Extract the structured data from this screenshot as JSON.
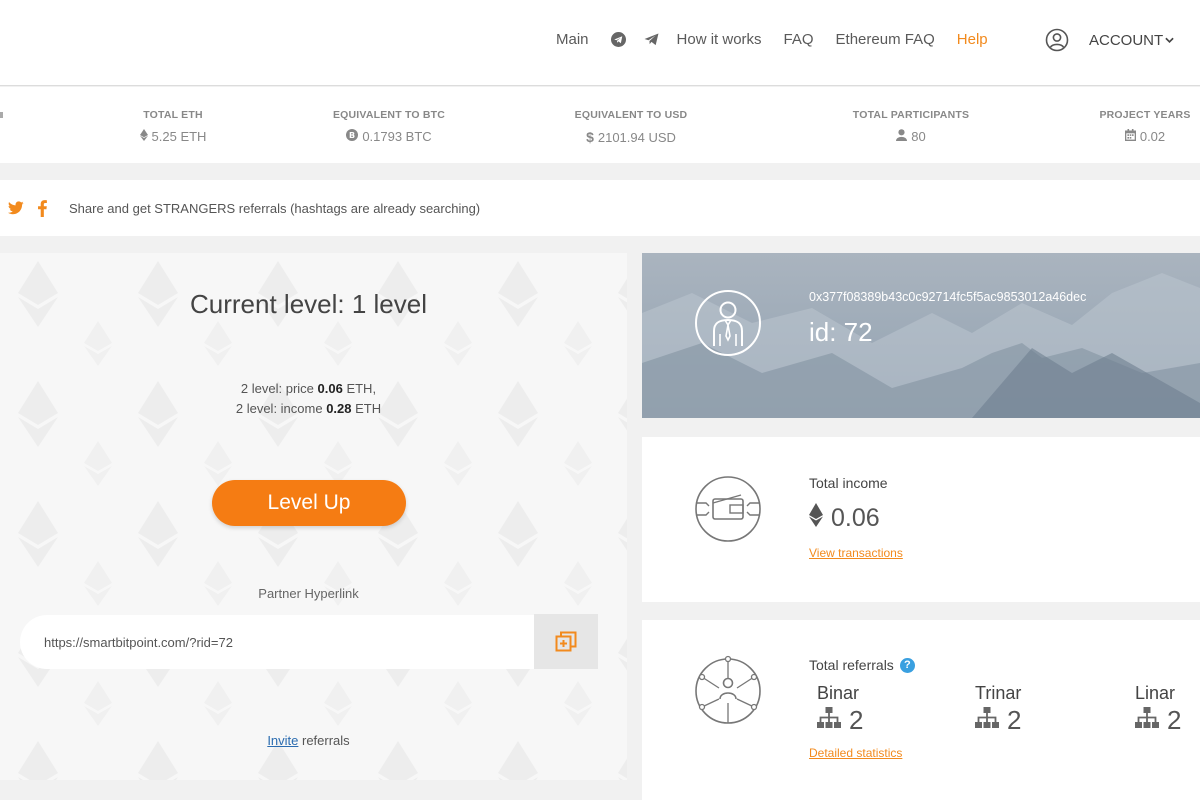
{
  "nav": {
    "main": "Main",
    "how": "How it works",
    "faq": "FAQ",
    "eth_faq": "Ethereum FAQ",
    "help": "Help",
    "account": "ACCOUNT"
  },
  "stats": [
    {
      "label": "TOTAL ETH",
      "value": "5.25 ETH",
      "icon": "ethereum-icon"
    },
    {
      "label": "EQUIVALENT TO BTC",
      "value": "0.1793 BTC",
      "icon": "bitcoin-icon"
    },
    {
      "label": "EQUIVALENT TO USD",
      "value": "2101.94 USD",
      "icon": "dollar-icon"
    },
    {
      "label": "TOTAL PARTICIPANTS",
      "value": "80",
      "icon": "user-icon"
    },
    {
      "label": "PROJECT YEARS",
      "value": "0.02",
      "icon": "calendar-icon"
    }
  ],
  "share": {
    "text": "Share and get STRANGERS referrals (hashtags are already searching)"
  },
  "level": {
    "current": "Current level: 1 level",
    "price_prefix": "2 level: price ",
    "price": "0.06",
    "price_suffix": " ETH,",
    "income_prefix": "2 level: income ",
    "income": "0.28",
    "income_suffix": " ETH",
    "button": "Level Up",
    "partner_label": "Partner Hyperlink",
    "partner_link": "https://smartbitpoint.com/?rid=72",
    "invite_link": "Invite",
    "invite_rest": " referrals"
  },
  "profile": {
    "address": "0x377f08389b43c0c92714fc5f5ac9853012a46dec",
    "id": "id: 72"
  },
  "income": {
    "title": "Total income",
    "amount": "0.06",
    "link": "View transactions"
  },
  "referrals": {
    "title": "Total referrals",
    "items": [
      {
        "name": "Binar",
        "count": "2"
      },
      {
        "name": "Trinar",
        "count": "2"
      },
      {
        "name": "Linar",
        "count": "2"
      }
    ],
    "link": "Detailed statistics"
  },
  "colors": {
    "accent": "#f57c13",
    "link": "#f28a1d",
    "info": "#3aa0e0"
  }
}
